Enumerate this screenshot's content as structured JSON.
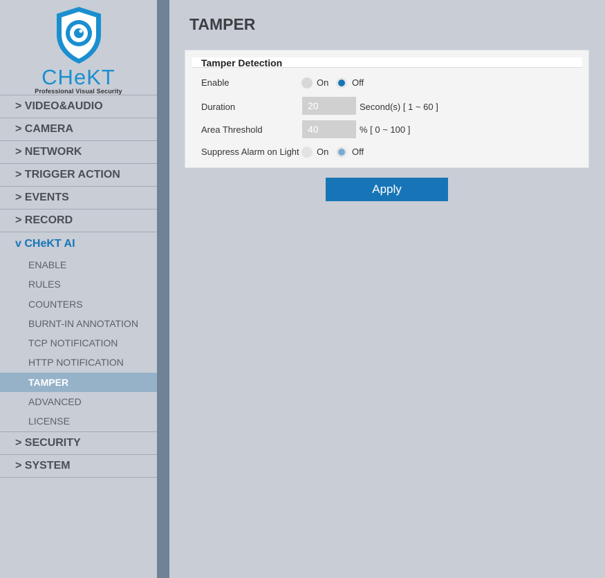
{
  "brand": {
    "name": "CHeKT",
    "tagline": "Professional Visual Security",
    "colors": {
      "accent": "#1a8fd0",
      "nav_open": "#1775b7",
      "active_bg": "#95b2c9"
    }
  },
  "sidebar": {
    "items": [
      {
        "label": "> VIDEO&AUDIO"
      },
      {
        "label": "> CAMERA"
      },
      {
        "label": "> NETWORK"
      },
      {
        "label": "> TRIGGER ACTION"
      },
      {
        "label": "> EVENTS"
      },
      {
        "label": "> RECORD"
      },
      {
        "label": "v CHeKT AI"
      }
    ],
    "sub_items": [
      {
        "label": "ENABLE"
      },
      {
        "label": "RULES"
      },
      {
        "label": "COUNTERS"
      },
      {
        "label": "BURNT-IN ANNOTATION"
      },
      {
        "label": "TCP NOTIFICATION"
      },
      {
        "label": "HTTP NOTIFICATION"
      },
      {
        "label": "TAMPER"
      },
      {
        "label": "ADVANCED"
      },
      {
        "label": "LICENSE"
      }
    ],
    "after_items": [
      {
        "label": "> SECURITY"
      },
      {
        "label": "> SYSTEM"
      }
    ],
    "active_sub": "TAMPER"
  },
  "page": {
    "title": "TAMPER",
    "panel_title": "Tamper Detection",
    "enable": {
      "label": "Enable",
      "on": "On",
      "off": "Off",
      "selected": "Off"
    },
    "duration": {
      "label": "Duration",
      "value": "20",
      "hint": "Second(s) [ 1 ~ 60 ]"
    },
    "area_threshold": {
      "label": "Area Threshold",
      "value": "40",
      "hint": "% [ 0 ~ 100 ]"
    },
    "suppress": {
      "label": "Suppress Alarm on Light",
      "on": "On",
      "off": "Off",
      "selected": "Off"
    },
    "apply_label": "Apply"
  }
}
